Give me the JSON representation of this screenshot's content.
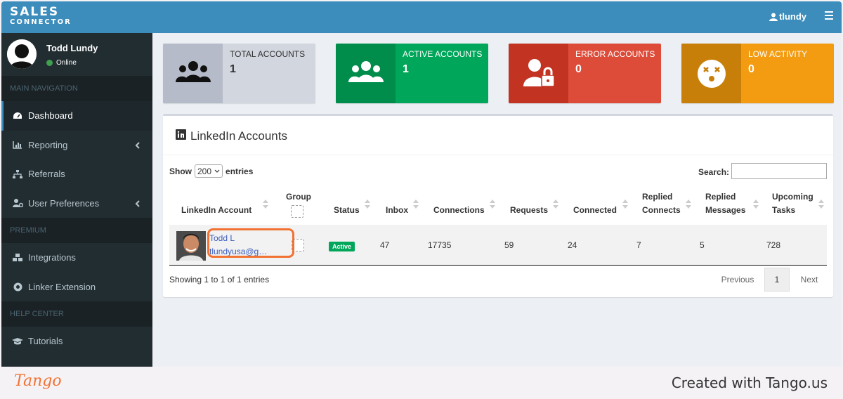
{
  "app": {
    "logo_line1": "SALES",
    "logo_line2": "CONNECTOR",
    "user": "tlundy"
  },
  "sidebar": {
    "profile_name": "Todd Lundy",
    "profile_status": "Online",
    "sections": {
      "main": "MAIN NAVIGATION",
      "premium": "PREMIUM",
      "help": "HELP CENTER"
    },
    "items": [
      {
        "label": "Dashboard",
        "icon": "dashboard-icon"
      },
      {
        "label": "Reporting",
        "icon": "chart-icon"
      },
      {
        "label": "Referrals",
        "icon": "sitemap-icon"
      },
      {
        "label": "User Preferences",
        "icon": "user-cog-icon"
      },
      {
        "label": "Integrations",
        "icon": "cubes-icon"
      },
      {
        "label": "Linker Extension",
        "icon": "chrome-icon"
      },
      {
        "label": "Tutorials",
        "icon": "graduation-cap-icon"
      }
    ]
  },
  "stats": [
    {
      "label": "TOTAL ACCOUNTS",
      "value": "1",
      "color": "#d2d6de",
      "icon_bg": "#b5bbc8"
    },
    {
      "label": "ACTIVE ACCOUNTS",
      "value": "1",
      "color": "#00a65a",
      "icon_bg": "#008d4c"
    },
    {
      "label": "ERROR ACCOUNTS",
      "value": "0",
      "color": "#dd4b39",
      "icon_bg": "#c23321"
    },
    {
      "label": "LOW ACTIVITY",
      "value": "0",
      "color": "#f39c12",
      "icon_bg": "#c87f0a"
    }
  ],
  "accounts": {
    "title": "LinkedIn Accounts",
    "show_label": "Show",
    "entries_value": "200",
    "entries_label": "entries",
    "search_label": "Search:",
    "columns": {
      "account": "LinkedIn Account",
      "group": "Group",
      "status": "Status",
      "inbox": "Inbox",
      "connections": "Connections",
      "requests": "Requests",
      "connected": "Connected",
      "replied_connects_1": "Replied",
      "replied_connects_2": "Connects",
      "replied_messages_1": "Replied",
      "replied_messages_2": "Messages",
      "upcoming_1": "Upcoming",
      "upcoming_2": "Tasks"
    },
    "row": {
      "name": "Todd L",
      "email": "tlundyusa@g…",
      "status": "Active",
      "inbox": "47",
      "connections": "17735",
      "requests": "59",
      "connected": "24",
      "replied_connects": "7",
      "replied_messages": "5",
      "upcoming_tasks": "728"
    },
    "showing": "Showing 1 to 1 of 1 entries",
    "pager": {
      "prev": "Previous",
      "page": "1",
      "next": "Next"
    }
  },
  "footer": {
    "brand": "Tango",
    "credit": "Created with Tango.us"
  }
}
